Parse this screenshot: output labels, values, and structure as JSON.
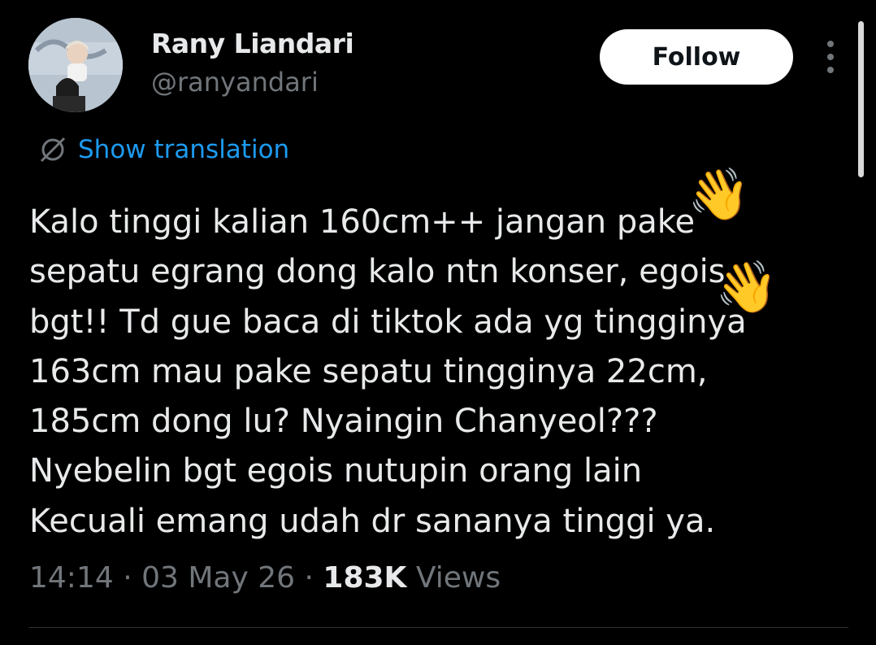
{
  "author": {
    "name": "Rany Liandari",
    "handle": "@ranyandari"
  },
  "follow_label": "Follow",
  "translation_label": "Show translation",
  "tweet": {
    "lines": [
      "Kalo tinggi kalian 160cm++ jangan pake",
      "sepatu egrang dong kalo ntn konser, egois",
      "bgt!! Td gue baca di tiktok ada yg tingginya",
      "163cm mau pake sepatu tingginya 22cm,",
      "185cm dong lu? Nyaingin Chanyeol???",
      "Nyebelin bgt egois nutupin orang lain",
      "Kecuali emang udah dr sananya tinggi ya."
    ],
    "emoji": [
      "👋",
      "👋"
    ]
  },
  "meta": {
    "time": "14:14",
    "separator": "·",
    "date": "03 May 26",
    "views_count": "183K",
    "views_label": "Views"
  },
  "colors": {
    "background": "#000000",
    "text": "#e7e9ea",
    "secondary": "#71767b",
    "link": "#1d9bf0",
    "button_bg": "#ffffff"
  },
  "icons": {
    "translate": "translate-icon",
    "more": "more-vertical-icon"
  }
}
